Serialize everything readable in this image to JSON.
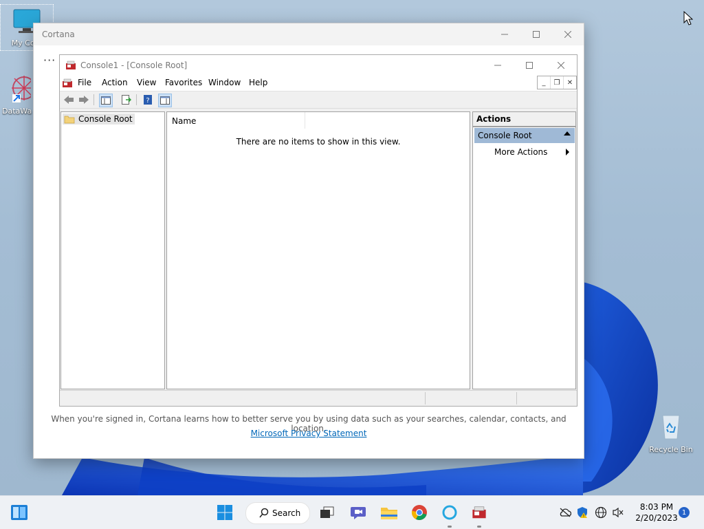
{
  "desktop": {
    "icons": [
      {
        "label": "My Com"
      },
      {
        "label": "DataWa"
      },
      {
        "label": "Recycle Bin"
      }
    ]
  },
  "cortana": {
    "title": "Cortana",
    "more_glyph": "···",
    "signin_note": "When you're signed in, Cortana learns how to better serve you by using data such as your searches, calendar, contacts, and location.",
    "privacy_link": "Microsoft Privacy Statement"
  },
  "mmc": {
    "title": "Console1 - [Console Root]",
    "menu": [
      "File",
      "Action",
      "View",
      "Favorites",
      "Window",
      "Help"
    ],
    "tree": {
      "root": "Console Root"
    },
    "list": {
      "column_name": "Name",
      "empty_message": "There are no items to show in this view."
    },
    "actions": {
      "title": "Actions",
      "section": "Console Root",
      "more": "More Actions"
    }
  },
  "taskbar": {
    "search_label": "Search",
    "clock_time": "8:03 PM",
    "clock_date": "2/20/2023",
    "notification_count": "1"
  },
  "colors": {
    "accent": "#0067b8",
    "actions_section_bg": "#9fb9d6",
    "wallpaper": "#a7bfd6"
  }
}
